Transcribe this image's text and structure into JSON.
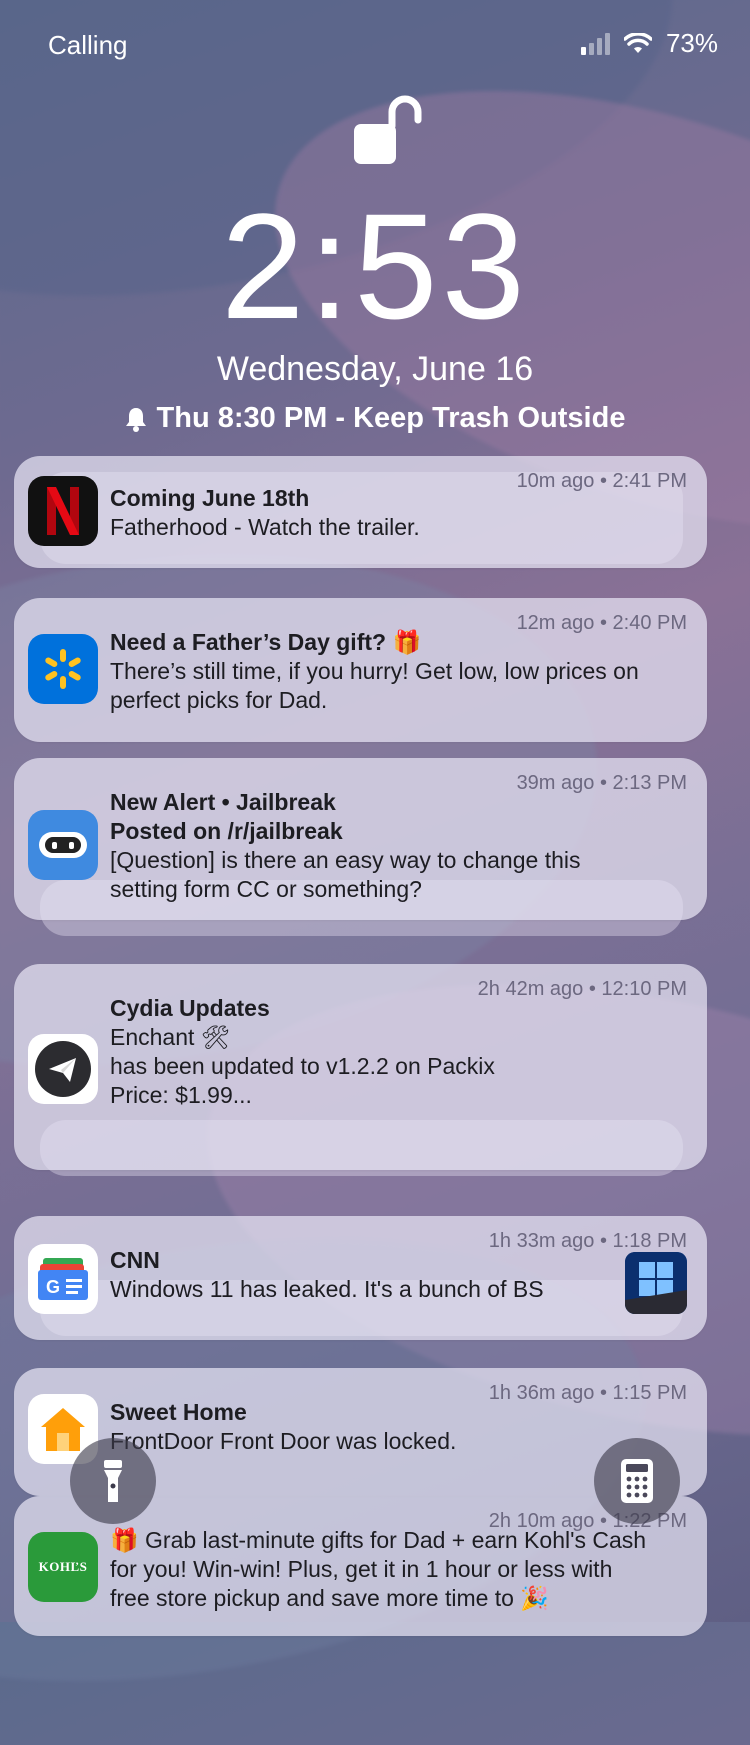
{
  "status": {
    "carrier": "Calling",
    "battery": "73%",
    "signal_bars_on": 1,
    "signal_bars_total": 4
  },
  "lockscreen": {
    "time": "2:53",
    "date": "Wednesday, June 16",
    "alarm": "Thu 8:30 PM - Keep Trash Outside"
  },
  "notifications": [
    {
      "app": "Netflix",
      "icon": "netflix-icon",
      "meta": "10m ago • 2:41 PM",
      "title": "Coming June 18th",
      "lines": [
        "Fatherhood - Watch the trailer."
      ]
    },
    {
      "app": "Walmart",
      "icon": "walmart-icon",
      "meta": "12m ago • 2:40 PM",
      "title": "Need a Father’s Day gift? 🎁",
      "lines": [
        "There’s still time, if you hurry! Get low, low prices on",
        "perfect picks for Dad."
      ]
    },
    {
      "app": "Apollo",
      "icon": "apollo-icon",
      "meta": "39m ago • 2:13 PM",
      "title": "New Alert • Jailbreak",
      "subtitle": "Posted on /r/jailbreak",
      "lines": [
        "[Question] is there an easy way to change this",
        "setting form CC or something?"
      ]
    },
    {
      "app": "Cydia",
      "icon": "telegram-icon",
      "meta": "2h 42m ago • 12:10 PM",
      "title": "Cydia Updates",
      "lines": [
        "Enchant 🛠",
        "has been updated to v1.2.2 on Packix",
        "Price: $1.99..."
      ]
    },
    {
      "app": "Google News",
      "icon": "google-news-icon",
      "meta": "1h 33m ago • 1:18 PM",
      "title": "CNN",
      "lines": [
        "Windows 11 has leaked. It's a bunch of BS"
      ]
    },
    {
      "app": "Home",
      "icon": "home-icon",
      "meta": "1h 36m ago • 1:15 PM",
      "title": "Sweet Home",
      "lines": [
        "FrontDoor Front Door was locked."
      ]
    },
    {
      "app": "Kohl's",
      "icon": "kohls-icon",
      "icon_text": "KOHĽS",
      "meta": "2h 10m ago • 1:22 PM",
      "lines": [
        "🎁 Grab last-minute gifts for Dad + earn Kohl's Cash",
        "for you! Win-win! Plus, get it in 1 hour or less with",
        "free store pickup and save more time to 🎉"
      ]
    }
  ],
  "colors": {
    "netflix": "#e50914",
    "walmart": "#0071dc",
    "walmart_spark": "#ffc220",
    "apollo": "#3f8ae0",
    "home": "#ff9f0a",
    "kohls": "#2a9a3a"
  }
}
